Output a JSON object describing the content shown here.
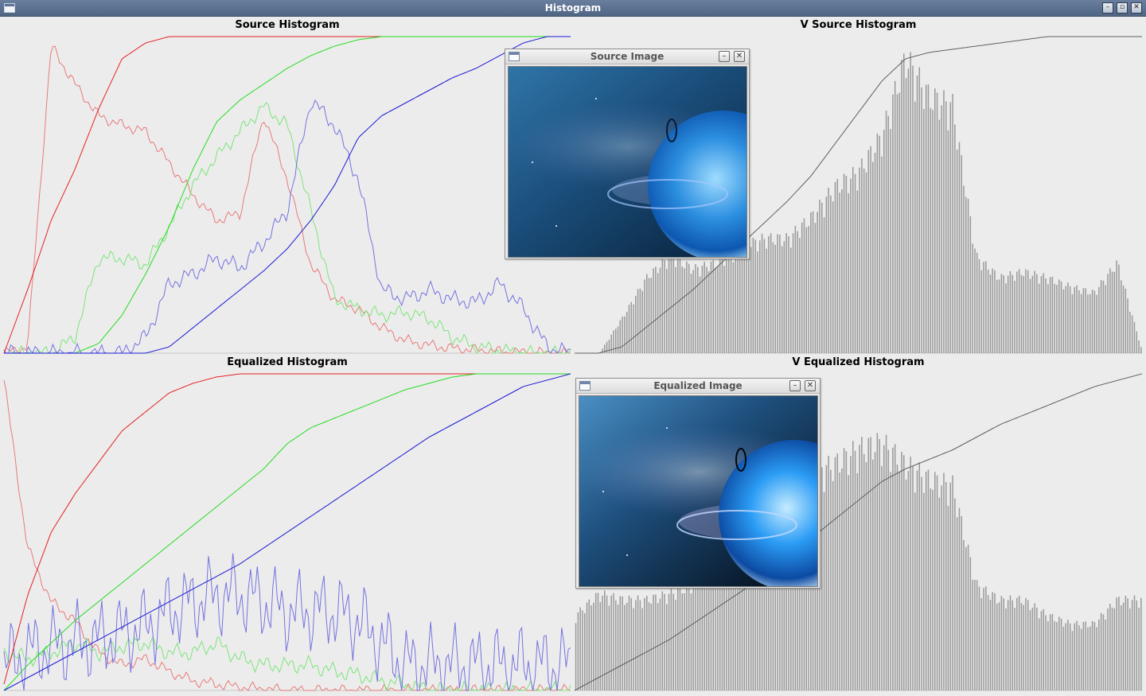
{
  "window": {
    "title": "Histogram",
    "icon": "window-menu-icon",
    "buttons": [
      {
        "name": "minimize-button",
        "glyph": "–"
      },
      {
        "name": "maximize-button",
        "glyph": "▫"
      },
      {
        "name": "close-button",
        "glyph": "✕"
      }
    ]
  },
  "panels": {
    "source_histogram": {
      "title": "Source Histogram"
    },
    "v_source_histogram": {
      "title": "V Source Histogram"
    },
    "equalized_histogram": {
      "title": "Equalized Histogram"
    },
    "v_equalized_histogram": {
      "title": "V Equalized Histogram"
    }
  },
  "subwindows": {
    "source_image": {
      "title": "Source Image",
      "minimize_glyph": "–",
      "close_glyph": "✕"
    },
    "equalized_image": {
      "title": "Equalized Image",
      "minimize_glyph": "–",
      "close_glyph": "✕"
    }
  },
  "colors": {
    "red": "#e32222",
    "green": "#22dd22",
    "blue": "#1a1ad4",
    "red_hist": "#e77a7a",
    "green_hist": "#7be47b",
    "blue_hist": "#7373e0",
    "gray_bar": "#9a9a9a",
    "gray_line": "#606060"
  },
  "chart_data": [
    {
      "type": "line",
      "title": "Source Histogram",
      "x": [
        0,
        255
      ],
      "series": [
        {
          "values": [
            0,
            0.02,
            0.97,
            0.85,
            0.75,
            0.72,
            0.7,
            0.6,
            0.5,
            0.42,
            0.44,
            0.75,
            0.55,
            0.28,
            0.17,
            0.14,
            0.08,
            0.04,
            0.025,
            0.015,
            0.01,
            0.005,
            0.002,
            0,
            0
          ]
        },
        {
          "values": [
            0,
            0,
            0,
            0.05,
            0.3,
            0.3,
            0.28,
            0.4,
            0.53,
            0.62,
            0.7,
            0.78,
            0.72,
            0.45,
            0.17,
            0.14,
            0.12,
            0.13,
            0.11,
            0.05,
            0.02,
            0.01,
            0,
            0,
            0
          ]
        },
        {
          "values": [
            0,
            0,
            0,
            0,
            0,
            0,
            0.05,
            0.22,
            0.25,
            0.3,
            0.27,
            0.35,
            0.45,
            0.8,
            0.72,
            0.55,
            0.2,
            0.17,
            0.2,
            0.17,
            0.16,
            0.22,
            0.14,
            0.02,
            0
          ]
        },
        {
          "values": [
            0,
            0.2,
            0.42,
            0.58,
            0.77,
            0.93,
            0.98,
            1,
            1,
            1,
            1,
            1,
            1,
            1,
            1,
            1,
            1,
            1,
            1,
            1,
            1,
            1,
            1,
            1,
            1
          ]
        },
        {
          "values": [
            0,
            0,
            0,
            0,
            0.03,
            0.12,
            0.25,
            0.4,
            0.58,
            0.73,
            0.8,
            0.85,
            0.9,
            0.94,
            0.97,
            0.99,
            1,
            1,
            1,
            1,
            1,
            1,
            1,
            1,
            1
          ]
        },
        {
          "values": [
            0,
            0,
            0,
            0,
            0,
            0,
            0,
            0.02,
            0.08,
            0.14,
            0.2,
            0.26,
            0.33,
            0.42,
            0.53,
            0.68,
            0.75,
            0.79,
            0.83,
            0.87,
            0.9,
            0.94,
            0.98,
            1,
            1
          ]
        }
      ]
    },
    {
      "type": "bar",
      "title": "V Source Histogram",
      "x": [
        0,
        255
      ],
      "values": [
        0,
        0,
        0.12,
        0.25,
        0.32,
        0.28,
        0.3,
        0.35,
        0.38,
        0.38,
        0.45,
        0.55,
        0.6,
        0.72,
        0.98,
        0.85,
        0.82,
        0.32,
        0.25,
        0.27,
        0.25,
        0.22,
        0.2,
        0.3,
        0.02
      ],
      "cdf": [
        0,
        0,
        0.02,
        0.08,
        0.14,
        0.2,
        0.27,
        0.34,
        0.41,
        0.48,
        0.56,
        0.66,
        0.76,
        0.86,
        0.93,
        0.95,
        0.96,
        0.97,
        0.98,
        0.99,
        1,
        1,
        1,
        1,
        1
      ]
    },
    {
      "type": "line",
      "title": "Equalized Histogram",
      "x": [
        0,
        255
      ],
      "series": [
        {
          "values": [
            0.98,
            0.45,
            0.28,
            0.22,
            0.12,
            0.08,
            0.1,
            0.06,
            0.03,
            0.02,
            0.01,
            0.005,
            0,
            0,
            0,
            0,
            0,
            0,
            0,
            0,
            0,
            0,
            0,
            0,
            0
          ]
        },
        {
          "values": [
            0.12,
            0.1,
            0.12,
            0.15,
            0.12,
            0.14,
            0.15,
            0.12,
            0.12,
            0.15,
            0.1,
            0.08,
            0.08,
            0.08,
            0.06,
            0.05,
            0.03,
            0.02,
            0,
            0,
            0,
            0,
            0,
            0,
            0
          ]
        },
        {
          "values": [
            0.08,
            0.12,
            0.14,
            0.15,
            0.16,
            0.18,
            0.2,
            0.25,
            0.28,
            0.3,
            0.3,
            0.28,
            0.25,
            0.25,
            0.25,
            0.22,
            0.15,
            0.08,
            0.08,
            0.08,
            0.08,
            0.08,
            0.08,
            0.08,
            0.08
          ]
        },
        {
          "values": [
            0.02,
            0.3,
            0.5,
            0.62,
            0.72,
            0.82,
            0.88,
            0.94,
            0.97,
            0.99,
            1,
            1,
            1,
            1,
            1,
            1,
            1,
            1,
            1,
            1,
            1,
            1,
            1,
            1,
            1
          ]
        },
        {
          "values": [
            0,
            0.08,
            0.15,
            0.22,
            0.28,
            0.34,
            0.4,
            0.46,
            0.52,
            0.58,
            0.64,
            0.7,
            0.78,
            0.83,
            0.86,
            0.89,
            0.92,
            0.95,
            0.97,
            0.99,
            1,
            1,
            1,
            1,
            1
          ]
        },
        {
          "values": [
            0,
            0.04,
            0.08,
            0.12,
            0.16,
            0.2,
            0.24,
            0.28,
            0.32,
            0.36,
            0.4,
            0.45,
            0.5,
            0.55,
            0.6,
            0.65,
            0.7,
            0.75,
            0.8,
            0.84,
            0.88,
            0.92,
            0.96,
            0.98,
            1
          ]
        }
      ]
    },
    {
      "type": "bar",
      "title": "V Equalized Histogram",
      "x": [
        0,
        255
      ],
      "values": [
        0.25,
        0.32,
        0.3,
        0.3,
        0.32,
        0.35,
        0.5,
        0.55,
        0.6,
        0.66,
        0.72,
        0.75,
        0.8,
        0.82,
        0.75,
        0.7,
        0.68,
        0.35,
        0.3,
        0.3,
        0.25,
        0.22,
        0.22,
        0.3,
        0.3
      ],
      "cdf": [
        0,
        0.04,
        0.08,
        0.12,
        0.16,
        0.21,
        0.26,
        0.31,
        0.36,
        0.42,
        0.48,
        0.54,
        0.6,
        0.66,
        0.7,
        0.73,
        0.76,
        0.8,
        0.84,
        0.87,
        0.9,
        0.93,
        0.96,
        0.98,
        1
      ]
    }
  ]
}
